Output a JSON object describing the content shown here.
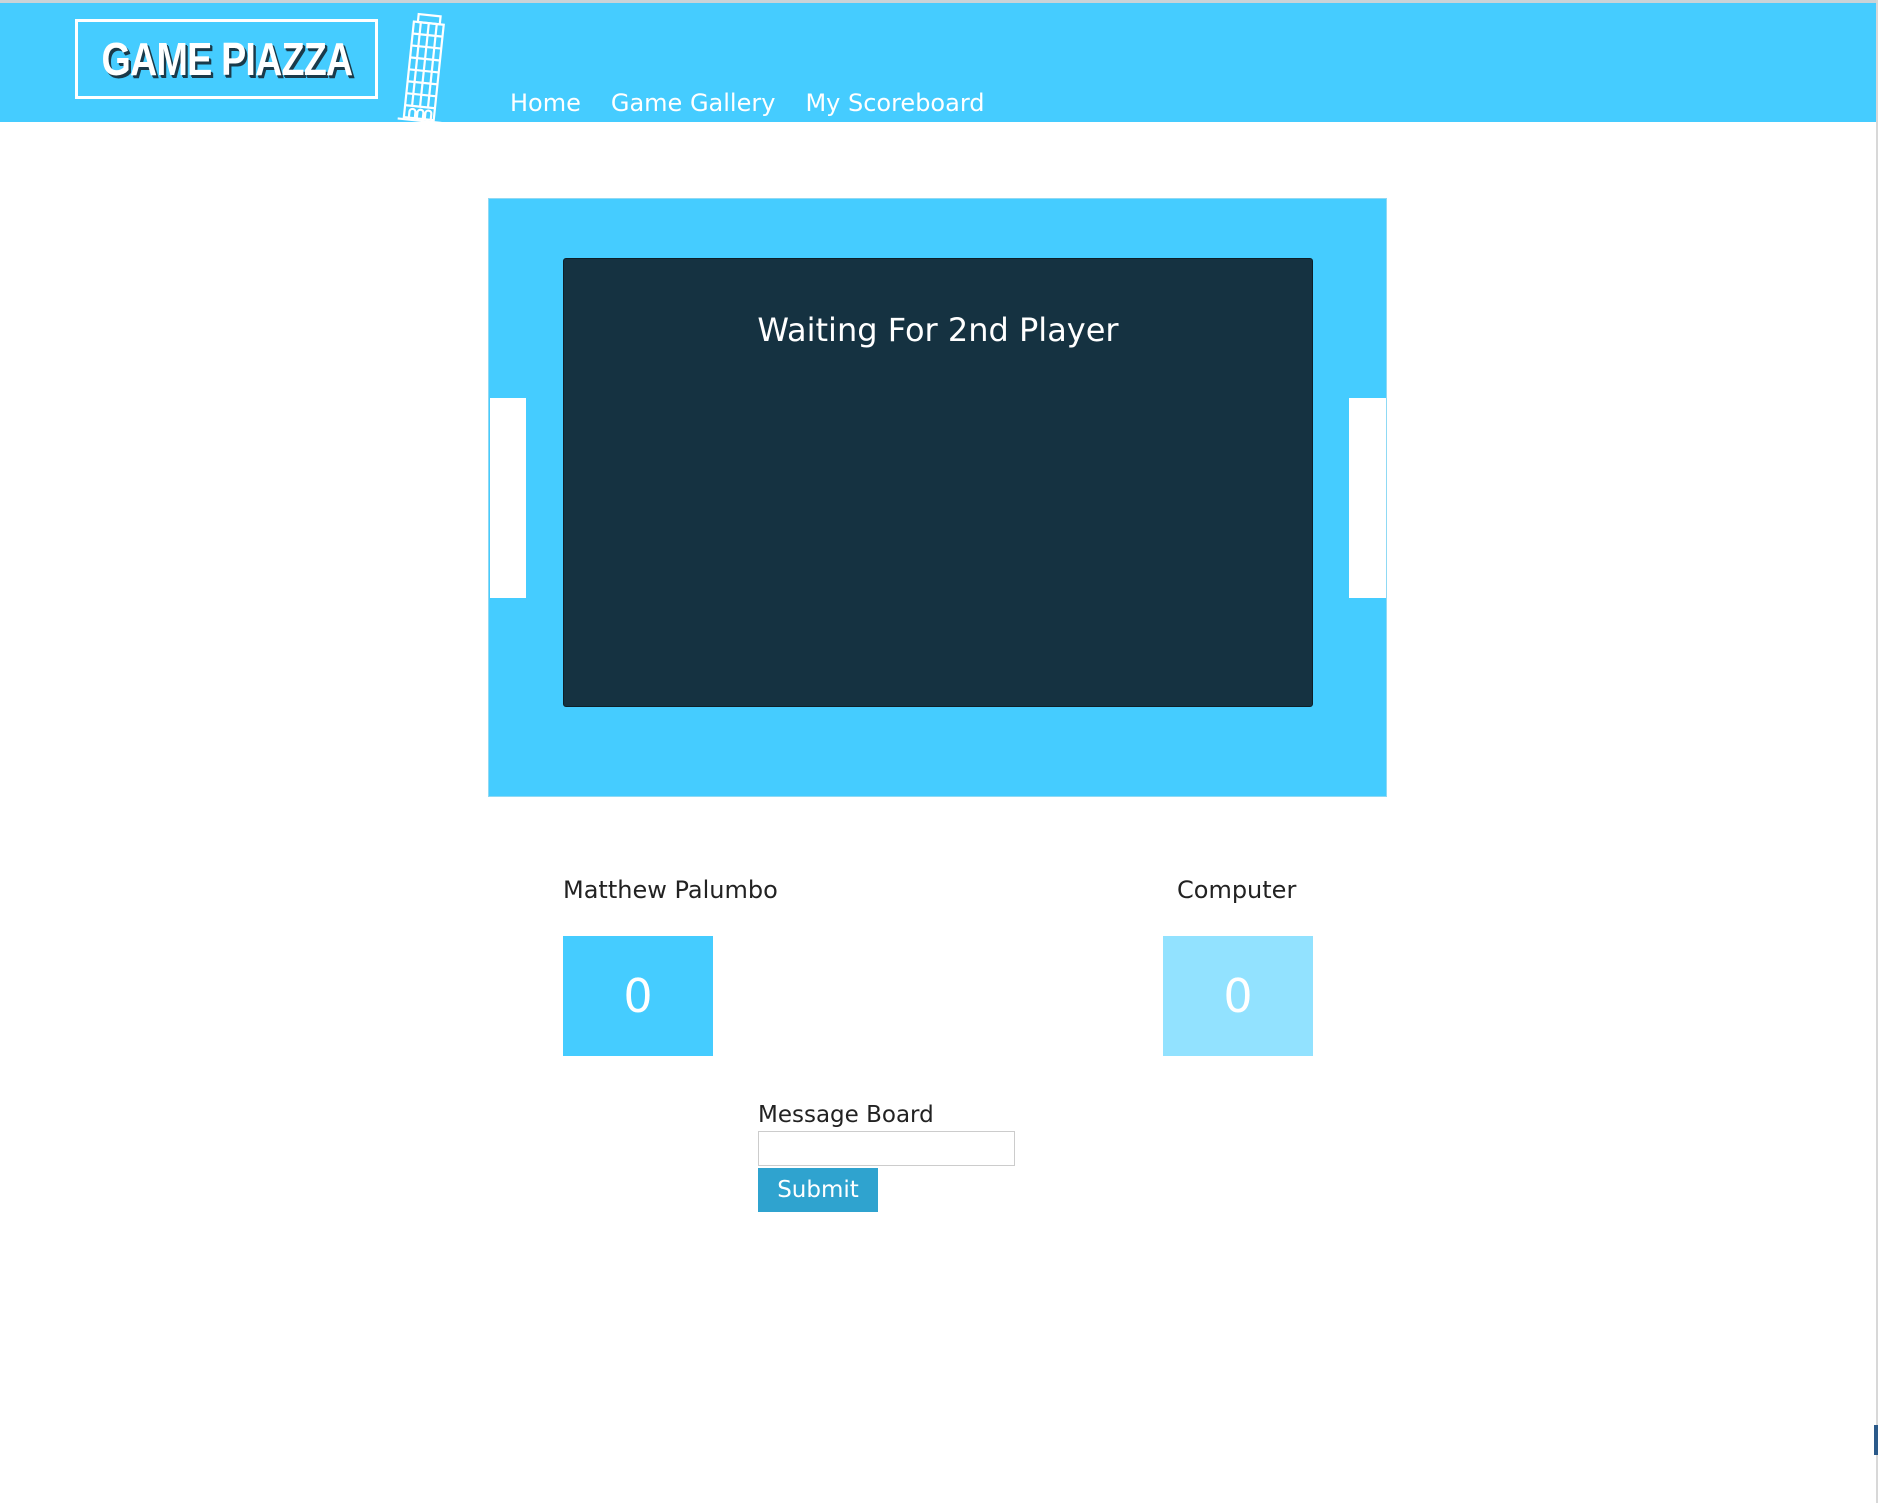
{
  "brand": {
    "logo_text": "GAME PIAZZA",
    "accent_color": "#45ccff",
    "logo_icon": "leaning-tower-icon"
  },
  "nav": {
    "items": [
      {
        "label": "Home"
      },
      {
        "label": "Game Gallery"
      },
      {
        "label": "My Scoreboard"
      }
    ]
  },
  "game": {
    "status": "Waiting For 2nd Player",
    "screen_color": "#153241"
  },
  "players": {
    "left": {
      "name": "Matthew Palumbo",
      "score": "0",
      "color": "#45ccff"
    },
    "right": {
      "name": "Computer",
      "score": "0",
      "color": "#92e2ff"
    }
  },
  "message_board": {
    "label": "Message Board",
    "input_value": "",
    "placeholder": "",
    "submit_label": "Submit",
    "submit_color": "#2fa3cf"
  }
}
